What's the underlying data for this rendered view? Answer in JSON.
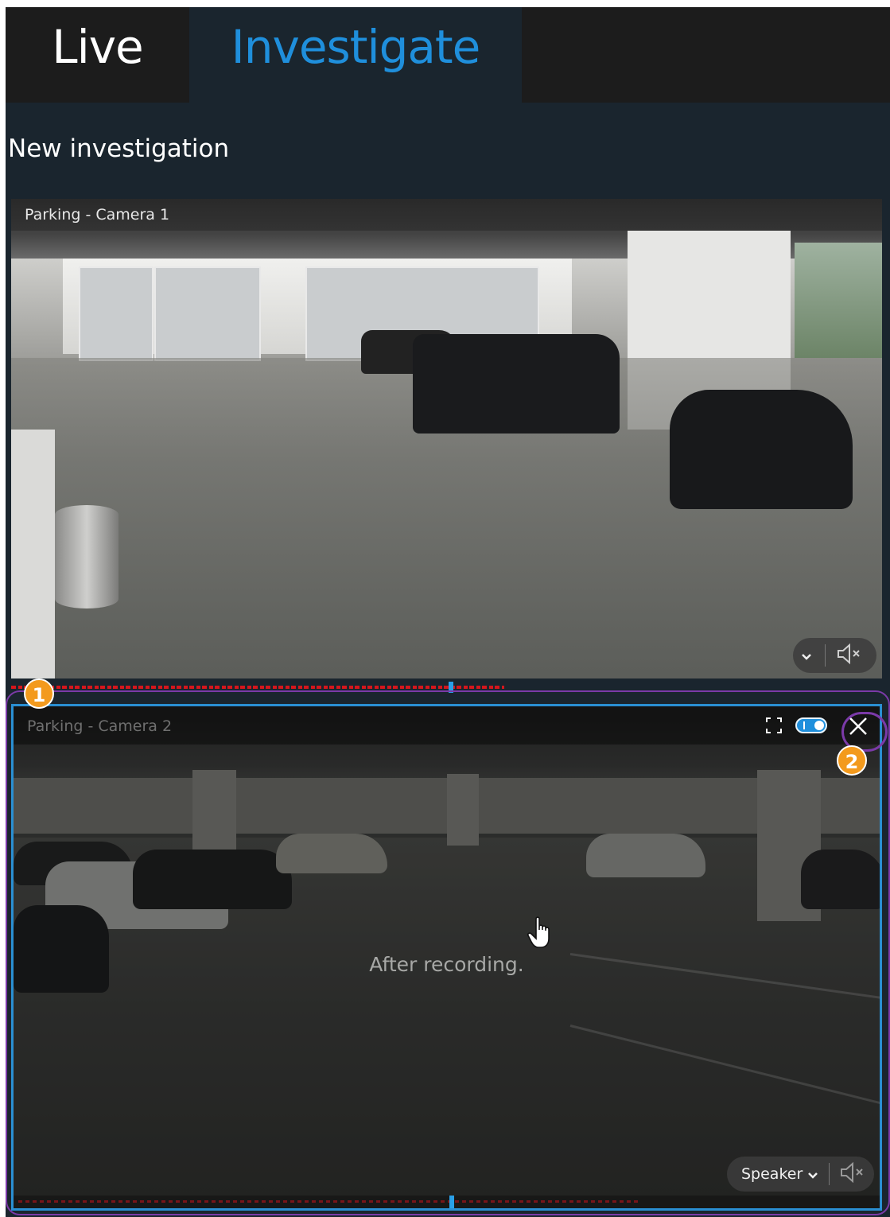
{
  "tabs": [
    {
      "label": "Live",
      "active": false
    },
    {
      "label": "Investigate",
      "active": true
    }
  ],
  "page_title": "New investigation",
  "camera1": {
    "label": "Parking - Camera 1",
    "audio": {
      "chevron": "⌄",
      "mute_icon": "speaker-muted-icon"
    }
  },
  "camera2": {
    "label": "Parking - Camera 2",
    "status": "After recording.",
    "audio": {
      "device": "Speaker",
      "chevron": "⌄",
      "mute_icon": "speaker-muted-icon"
    },
    "tools": {
      "fullscreen_icon": "fullscreen-icon",
      "toggle_on": true,
      "close_icon": "close-icon"
    }
  },
  "callouts": [
    "1",
    "2"
  ],
  "colors": {
    "accent": "#1f8fdc",
    "callout": "#f39a1d",
    "highlight": "#7b3aa8",
    "recorded": "#d6161c"
  }
}
